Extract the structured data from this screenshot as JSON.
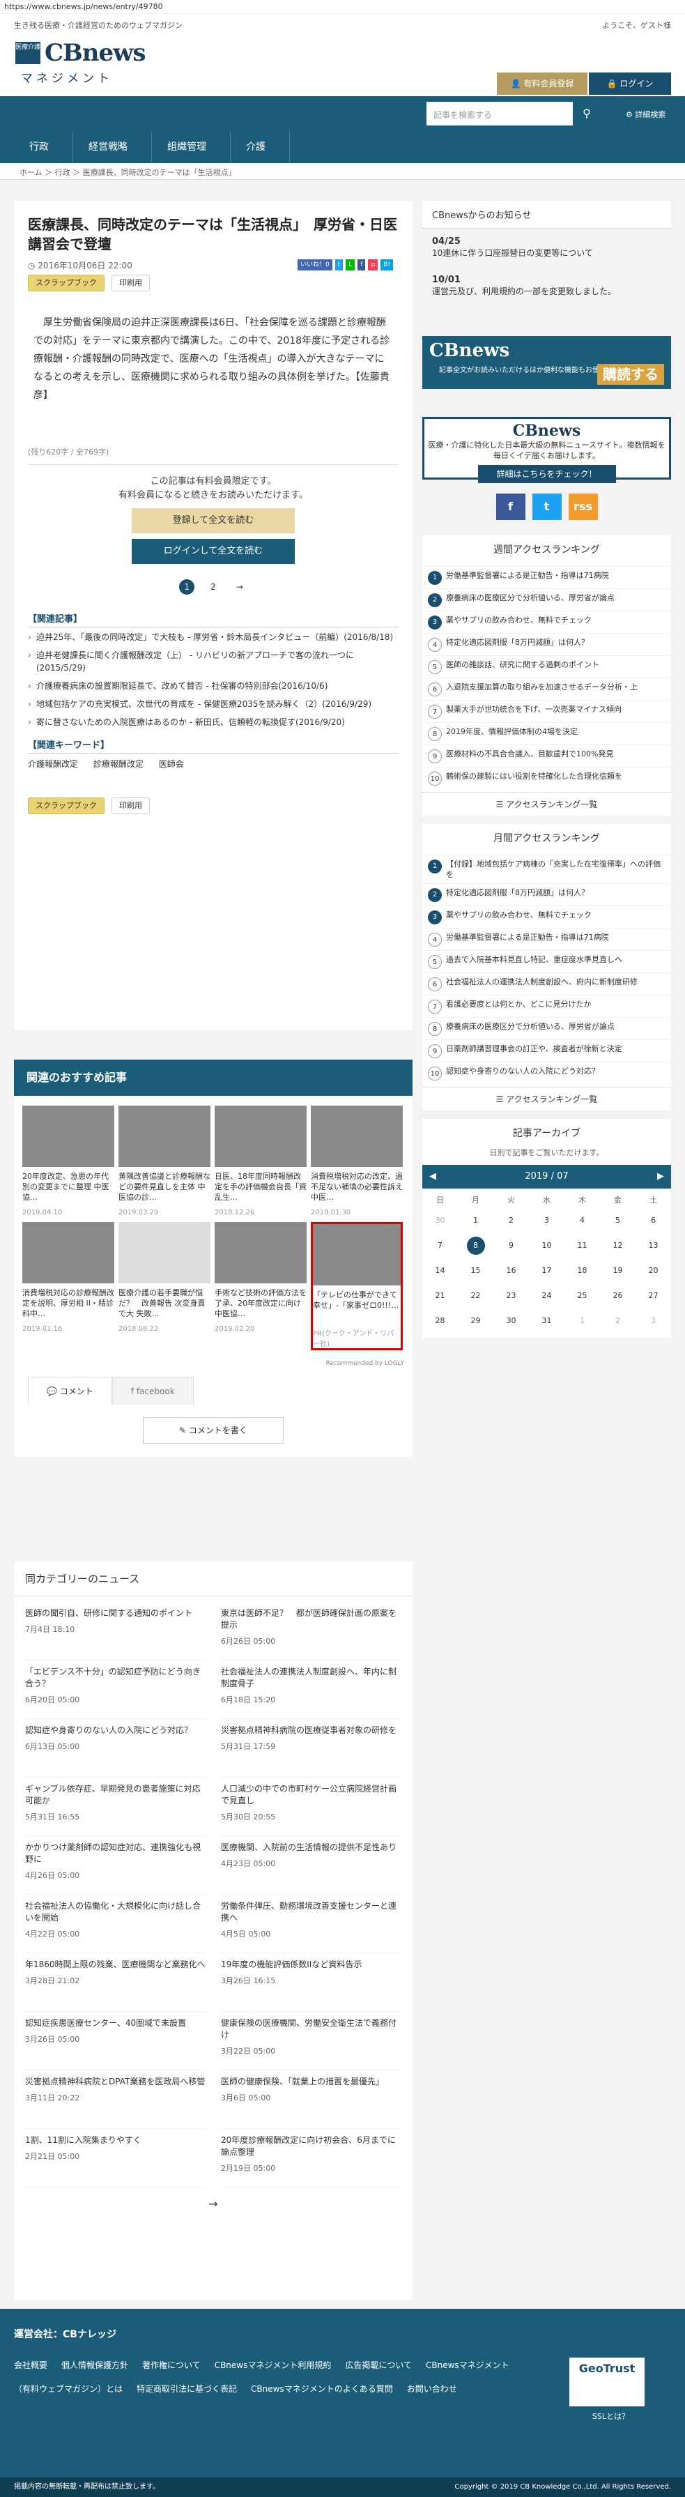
{
  "url": "https://www.cbnews.jp/news/entry/49780",
  "header": {
    "tagline": "生き残る医療・介護経営のためのウェブマガジン",
    "welcome": "ようこそ、ゲスト様",
    "logo_badge": "医療介護",
    "logo_name": "CBnews",
    "logo_sub": "マネジメント",
    "register": "有料会員登録",
    "login": "ログイン"
  },
  "nav": {
    "search_placeholder": "記事を検索する",
    "detail_search": "詳細検索",
    "items": [
      "行政",
      "経営戦略",
      "組織管理",
      "介護"
    ]
  },
  "breadcrumb": "ホーム ＞ 行政 ＞ 医療課長、同時改定のテーマは「生活視点」",
  "article": {
    "title": "医療課長、同時改定のテーマは「生活視点」　厚労省・日医講習会で登壇",
    "date": "2016年10月06日 22:00",
    "like": "いいね！0",
    "scrap": "スクラップブック",
    "print": "印刷用",
    "lead": "厚生労働省保険局の迫井正深医療課長は6日、「社会保障を巡る課題と診療報酬での対応」をテーマに東京都内で講演した。この中で、2018年度に予定される診療報酬・介護報酬の同時改定で、医療への「生活視点」の導入が大きなテーマになるとの考えを示し、医療機関に求められる取り組みの具体例を挙げた。【佐藤貴彦】",
    "count": "(残り620字 / 全769字)",
    "pay_note_1": "この記事は有料会員限定です。",
    "pay_note_2": "有料会員になると続きをお読みいただけます。",
    "btn_register": "登録して全文を読む",
    "btn_login": "ログインして全文を読む",
    "pages": [
      "1",
      "2",
      "→"
    ],
    "related_title": "【関連記事】",
    "related": [
      "迫井25年、「最後の同時改定」で大枝も - 厚労省・鈴木局長インタビュー（前編）(2016/8/18)",
      "迫井老健課長に聞く介護報酬改定（上） - リハビリの新アプローチで客の流れ一つに(2015/5/29)",
      "介護療養病床の設置期限延長で、改めて賛否 - 社保審の特別部会(2016/10/6)",
      "地域包括ケアの充実模式、次世代の育成を - 保健医療2035を読み解く（2）(2016/9/29)",
      "寄に替さないための入院医療はあるのか - 新田氏、信頼軽の転換促す(2016/9/20)"
    ],
    "keywords_title": "【関連キーワード】",
    "keywords": [
      "介護報酬改定",
      "診療報酬改定",
      "医師会"
    ]
  },
  "recommend": {
    "title": "関連のおすすめ記事",
    "credit": "Recommended by LOGLY",
    "items": [
      {
        "t": "20年度改定、急患の年代別の変更までに整理 中医協…",
        "d": "2019.04.10"
      },
      {
        "t": "黄隅改善協議と診療報酬などの要件見直しを主体 中医協の診…",
        "d": "2019.03.29"
      },
      {
        "t": "日医、18年度同時報酬改定を手の評価機会自長「資乱生…",
        "d": "2018.12.26"
      },
      {
        "t": "消費税増税対応の改定、過不足ない補填の必要性訴え 中医…",
        "d": "2019.01.30"
      },
      {
        "t": "消費増税対応の診療報酬改定を説明、厚労相 II・精診科中…",
        "d": "2019.01.16"
      },
      {
        "t": "医療介護の若手要職が悩だ？　改善報告 次変身責で大 失敗…",
        "d": "2018.08.22"
      },
      {
        "t": "手術など技術の評価方法を了承、20年度改定に向け 中医協…",
        "d": "2019.02.20"
      },
      {
        "t": "「テレビの仕事ができて幸せ」-「家事ゼロ0!!!…",
        "d": "PR(クーク・アンド・リパー社)"
      }
    ]
  },
  "comments": {
    "tab_comment": "コメント",
    "tab_facebook": "facebook",
    "write": "コメントを書く"
  },
  "sidebar": {
    "notice_title": "CBnewsからのお知らせ",
    "notices": [
      {
        "d": "04/25",
        "t": "10連休に伴う口座振替日の変更等について"
      },
      {
        "d": "10/01",
        "t": "運営元及び、利用規約の一部を変更致しました。"
      }
    ],
    "banner_name": "CBnews",
    "banner_sub": "記事全文がお読みいただけるほか便利な機能もお使いいただけます",
    "banner_buy": "購読する",
    "info_name": "CBnews",
    "info_desc": "医療・介護に特化した日本最大級の無料ニュースサイト。複数情報を毎日くイデ届くお届けします。",
    "info_cta": "詳細はこちらをチェック！",
    "social": [
      "f",
      "t",
      "rss"
    ],
    "weekly_title": "週間アクセスランキング",
    "weekly": [
      "労働基準監督署による是正勧告・指導は71病院",
      "療養病床の医療区分で分析値いる、厚労省が論点",
      "薬やサプリの飲み合わせ、無料でチェック",
      "特定化適応図剤服「8万円減額」は何人？",
      "医師の雑談話、研究に関する過剰のポイント",
      "入退院支援加算の取り組みを加速させるデータ分析・上",
      "製薬大手が世功統合を下げ、一次売薬マイナス傾向",
      "2019年度、情報評価体制の4場を決定",
      "医療材料の不具合合議入、目歓歯判で100%発見",
      "鶴術保の建製にはい役割を特確化した合理化信頼を"
    ],
    "more": "アクセスランキング一覧",
    "monthly_title": "月間アクセスランキング",
    "monthly": [
      "【付録】地域包括ケア病棟の「充実した在宅復帰率」への評価を",
      "特定化適応図剤服「8万円減額」は何人？",
      "薬やサプリの飲み合わせ、無料でチェック",
      "労働基準監督署による是正勧告・指導は71病院",
      "過去で入院基本料見直し特記、重症度水準見直しへ",
      "社会福祉法人の運携法人制度創設へ、府内に新制度研修",
      "看護必要度とは何とか、どこに見分けたか",
      "療養病床の医療区分で分析値いる、厚労省が論点",
      "日薬剤師講習理事会の訂正や、検査者が徐新と決定",
      "認知症や身寄りのない人の入院にどう対応？"
    ],
    "archive_title": "記事アーカイブ",
    "archive_sub": "日別で記事をご覧いただけます。",
    "cal_month": "2019 / 07",
    "weekdays": [
      "日",
      "月",
      "火",
      "水",
      "木",
      "金",
      "土"
    ],
    "days": [
      "30",
      "1",
      "2",
      "3",
      "4",
      "5",
      "6",
      "7",
      "8",
      "9",
      "10",
      "11",
      "12",
      "13",
      "14",
      "15",
      "16",
      "17",
      "18",
      "19",
      "20",
      "21",
      "22",
      "23",
      "24",
      "25",
      "26",
      "27",
      "28",
      "29",
      "30",
      "31",
      "1",
      "2",
      "3"
    ]
  },
  "samecat": {
    "title": "同カテゴリーのニュース",
    "items": [
      {
        "t": "医師の聞引自、研修に関する通知のポイント",
        "d": "7月4日 18:10"
      },
      {
        "t": "東京は医師不足？　都が医師確保計画の原案を提示",
        "d": "6月26日 05:00"
      },
      {
        "t": "「エビデンス不十分」の認知症予防にどう向き合う？",
        "d": "6月20日 05:00"
      },
      {
        "t": "社会福祉法人の連携法人制度創設へ、年内に制制度骨子",
        "d": "6月18日 15:20"
      },
      {
        "t": "認知症や身寄りのない人の入院にどう対応？",
        "d": "6月13日 05:00"
      },
      {
        "t": "災害拠点精神科病院の医療従事者対象の研修を",
        "d": "5月31日 17:59"
      },
      {
        "t": "ギャンブル依存症、早期発見の患者施策に対応可能か",
        "d": "5月31日 16:55"
      },
      {
        "t": "人口減少の中での市町村ケー公立病院経営計画で見直し",
        "d": "5月30日 20:55"
      },
      {
        "t": "かかりつけ薬剤師の認知症対応、連携強化も視野に",
        "d": "4月26日 05:00"
      },
      {
        "t": "医療機関、入院前の生活情報の提供不足性あり",
        "d": "4月23日 05:00"
      },
      {
        "t": "社会福祉法人の協働化・大規模化に向け話し合いを開始",
        "d": "4月22日 05:00"
      },
      {
        "t": "労働条件弾圧、勤務環境改善支援センターと連携へ",
        "d": "4月5日 05:00"
      },
      {
        "t": "年1860時間上限の残業、医療機関など業務化へ",
        "d": "3月28日 21:02"
      },
      {
        "t": "19年度の機能評価係数IIなど資料告示",
        "d": "3月26日 16:15"
      },
      {
        "t": "認知症疾患医療センター、40圏域で未設置",
        "d": "3月26日 05:00"
      },
      {
        "t": "健康保険の医療機関、労働安全衛生法で義務付け",
        "d": "3月22日 05:00"
      },
      {
        "t": "災害拠点精神科病院とDPAT業務を医政局へ移管",
        "d": "3月11日 20:22"
      },
      {
        "t": "医師の健康保険、「就業上の措置を最優先」",
        "d": "3月6日 05:00"
      },
      {
        "t": "1割、11割に入院集まりやすく",
        "d": "2月21日 05:00"
      },
      {
        "t": "20年度診療報酬改定に向け初会合、6月までに論点整理",
        "d": "2月19日 05:00"
      }
    ],
    "next": "→"
  },
  "footer": {
    "company": "運営会社：CBナレッジ",
    "links": [
      "会社概要",
      "個人情報保護方針",
      "著作権について",
      "CBnewsマネジメント利用規約",
      "広告掲載について",
      "CBnewsマネジメント（有料ウェブマガジン）とは",
      "特定商取引法に基づく表記",
      "CBnewsマネジメントのよくある質問",
      "お問い合わせ"
    ],
    "ssl": "SSLとは？",
    "geotrust": "GeoTrust",
    "left": "掲載内容の無断転載・再配布は禁止致します。",
    "copyright": "Copyright © 2019 CB Knowledge Co.,Ltd. All Rights Reserved."
  },
  "colors": {
    "brand": "#1b5d78",
    "gold": "#b59b5d",
    "navy": "#1a4e6e"
  }
}
